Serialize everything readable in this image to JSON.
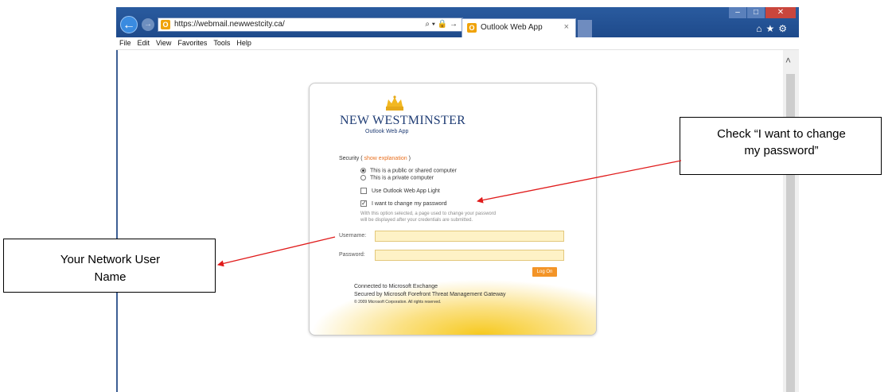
{
  "browser": {
    "address_url": "https://webmail.newwestcity.ca/",
    "address_tools": "⌕ ▾ 🔒 →",
    "tab_title": "Outlook Web App",
    "tab_close": "×",
    "favicon_letter": "O",
    "back_glyph": "←",
    "forward_glyph": "→",
    "window_controls": {
      "minimize": "–",
      "maximize": "□",
      "close": "✕"
    },
    "toolbar_icons": "⌂★⚙",
    "menu": [
      "File",
      "Edit",
      "View",
      "Favorites",
      "Tools",
      "Help"
    ],
    "scroll_up_glyph": "˄"
  },
  "login": {
    "brand": "NEW WESTMINSTER",
    "sub_brand": "Outlook Web App",
    "security_label": "Security (",
    "show_explanation": "show explanation",
    "security_close": ")",
    "options": {
      "public_computer": "This is a public or shared computer",
      "private_computer": "This is a private computer",
      "owa_light": "Use Outlook Web App Light",
      "change_password": "I want to change my password"
    },
    "change_password_note_1": "With this option selected, a page used to change your password",
    "change_password_note_2": "will be displayed after your credentials are submitted.",
    "username_label": "Username:",
    "password_label": "Password:",
    "username_value": "",
    "password_value": "",
    "logon_button": "Log On",
    "footer_exchange": "Connected to Microsoft Exchange",
    "footer_gateway": "Secured by Microsoft Forefront Threat Management Gateway",
    "footer_copyright": "© 2009 Microsoft Corporation. All rights reserved.",
    "checked_mark": "✓"
  },
  "annotations": {
    "username_callout_line1": "Your Network User",
    "username_callout_line2": "Name",
    "password_callout_line1": "Check “I want to change",
    "password_callout_line2": "my password”"
  },
  "colors": {
    "accent_orange": "#f39427",
    "brand_navy": "#1f3c74",
    "arrow_red": "#e01b1b"
  },
  "icons": {
    "back": "back-arrow-icon",
    "forward": "forward-arrow-icon",
    "favicon": "outlook-icon",
    "home": "home-icon",
    "favorites": "star-icon",
    "tools": "gear-icon",
    "logo": "crown-icon"
  }
}
